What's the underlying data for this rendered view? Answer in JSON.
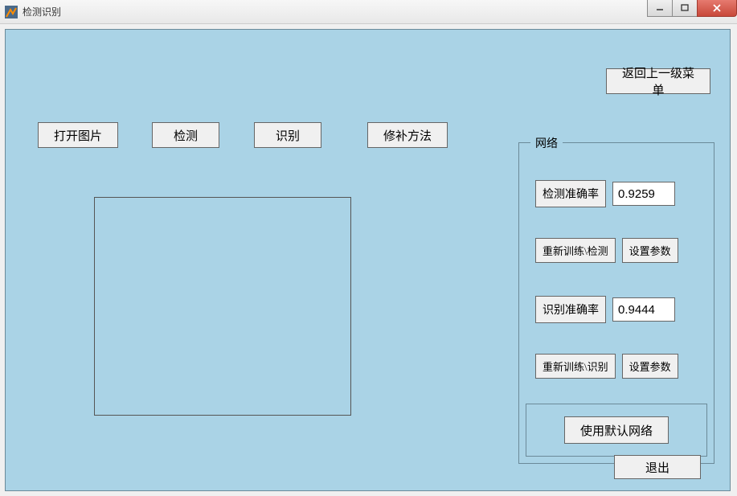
{
  "window": {
    "title": "检测识别"
  },
  "toolbar": {
    "open_image": "打开图片",
    "detect": "检测",
    "recognize": "识别",
    "repair_method": "修补方法",
    "return_menu": "返回上一级菜单",
    "exit": "退出"
  },
  "network_group": {
    "title": "网络",
    "detect_accuracy_label": "检测准确率",
    "detect_accuracy_value": "0.9259",
    "retrain_detect": "重新训练\\检测",
    "detect_set_params": "设置参数",
    "recognize_accuracy_label": "识别准确率",
    "recognize_accuracy_value": "0.9444",
    "retrain_recognize": "重新训练\\识别",
    "recognize_set_params": "设置参数",
    "use_default_network": "使用默认网络"
  }
}
